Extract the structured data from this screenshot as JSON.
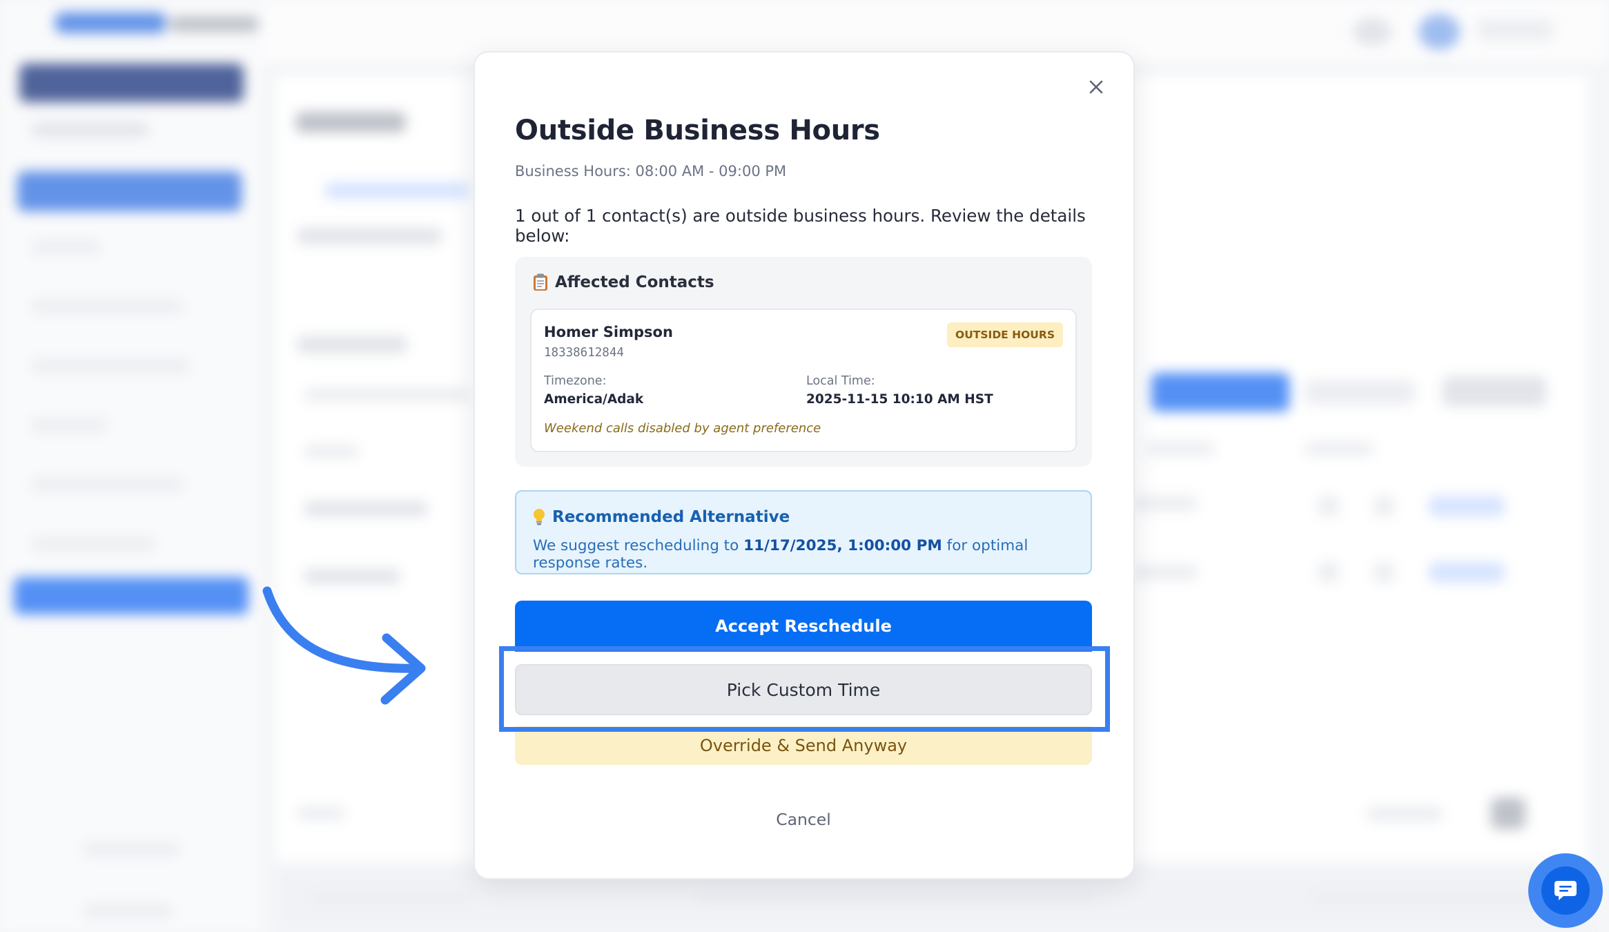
{
  "modal": {
    "title": "Outside Business Hours",
    "business_hours": "Business Hours: 08:00 AM - 09:00 PM",
    "summary": "1 out of 1 contact(s) are outside business hours. Review the details below:",
    "affected": {
      "heading": "Affected Contacts",
      "icon": "clipboard-icon",
      "contact": {
        "name": "Homer Simpson",
        "phone": "18338612844",
        "badge": "OUTSIDE HOURS",
        "timezone_label": "Timezone:",
        "timezone_value": "America/Adak",
        "local_time_label": "Local Time:",
        "local_time_value": "2025-11-15 10:10 AM HST",
        "note": "Weekend calls disabled by agent preference"
      }
    },
    "recommendation": {
      "heading": "Recommended Alternative",
      "icon": "lightbulb-icon",
      "text_before": "We suggest rescheduling to",
      "datetime": "11/17/2025, 1:00:00 PM",
      "text_after": "for optimal response rates."
    },
    "buttons": {
      "accept": "Accept Reschedule",
      "custom": "Pick Custom Time",
      "override": "Override & Send Anyway",
      "cancel": "Cancel"
    }
  },
  "colors": {
    "primary": "#066ef5",
    "highlight": "#3a7ff0",
    "badge_bg": "#fdefc2",
    "recommend_bg": "#e7f4fd"
  }
}
